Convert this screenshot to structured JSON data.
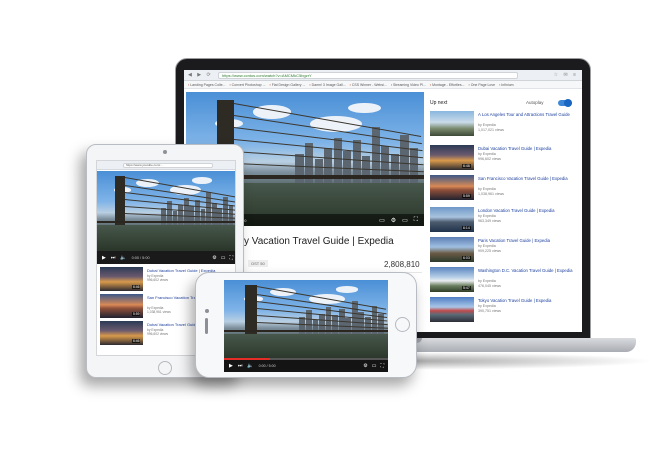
{
  "browser": {
    "url": "https://www.ccntus.com/watch?v=AMCMkC5bgzrY",
    "bookmarks": [
      "Landing Pages Colle...",
      "Convert Photoshop ...",
      "Flat Design Gallery ...",
      "Damn! 3 Image Gall...",
      "CSS Winner - Websi...",
      "Streaming Video Pl...",
      "Montage - Effortles...",
      "One Page Love",
      "Infinium"
    ]
  },
  "laptop": {
    "video_title": "y Vacation Travel Guide | Expedia",
    "badge": "OST 50",
    "views": "2,808,810",
    "time": "0:00 / 5:00"
  },
  "sidebar": {
    "heading": "Up next",
    "autoplay_label": "Autoplay",
    "items": [
      {
        "title": "A Los Angeles Tour and Attractions Travel Guide",
        "channel": "by Expedia",
        "views": "1,017,021 views",
        "duration": "",
        "thumb": "th-la"
      },
      {
        "title": "Dubai Vacation Travel Guide | Expedia",
        "channel": "by Expedia",
        "views": "996,602 views",
        "duration": "6:46",
        "thumb": "th-dubai1"
      },
      {
        "title": "San Francisco Vacation Travel Guide | Expedia",
        "channel": "by Expedia",
        "views": "1,038,961 views",
        "duration": "5:59",
        "thumb": "th-sf"
      },
      {
        "title": "London Vacation Travel Guide | Expedia",
        "channel": "by Expedia",
        "views": "963,349 views",
        "duration": "6:14",
        "thumb": "th-london"
      },
      {
        "title": "Paris Vacation Travel Guide | Expedia",
        "channel": "by Expedia",
        "views": "909,225 views",
        "duration": "6:03",
        "thumb": "th-paris"
      },
      {
        "title": "Washington D.C. Vacation Travel Guide | Expedia",
        "channel": "by Expedia",
        "views": "476,045 views",
        "duration": "5:47",
        "thumb": "th-dc"
      },
      {
        "title": "Tokyo Vacation Travel Guide | Expedia",
        "channel": "by Expedia",
        "views": "390,751 views",
        "duration": "",
        "thumb": "th-tokyo"
      }
    ]
  },
  "tablet": {
    "url": "https://www.youtube.com/...",
    "time": "0:00 / 5:00",
    "items": [
      {
        "title": "Dubai Vacation Travel Guide | Expedia",
        "channel": "by Expedia",
        "views": "996,602 views",
        "duration": "6:46",
        "thumb": "th-dubai1"
      },
      {
        "title": "San Francisco Vacation Travel Guide | Expedia",
        "channel": "by Expedia",
        "views": "1,038,961 views",
        "duration": "5:59",
        "thumb": "th-sf"
      },
      {
        "title": "Dubai Vacation Travel Guide | Expedia",
        "channel": "by Expedia",
        "views": "996,602 views",
        "duration": "6:46",
        "thumb": "th-dubai1"
      }
    ]
  },
  "phone": {
    "time": "0:00 / 5:00",
    "progress": 0.28
  },
  "icons": {
    "play": "▶",
    "volume": "🔊",
    "settings": "⚙",
    "fullscreen": "⛶"
  }
}
